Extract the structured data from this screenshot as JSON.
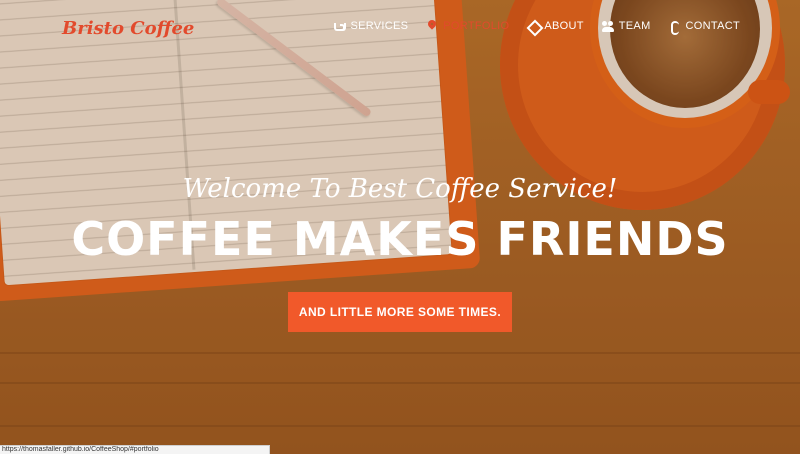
{
  "brand": "Bristo Coffee",
  "nav": {
    "items": [
      {
        "label": "SERVICES",
        "icon": "coffee-cup-icon"
      },
      {
        "label": "PORTFOLIO",
        "icon": "map-pin-icon",
        "active": true
      },
      {
        "label": "ABOUT",
        "icon": "diamond-icon"
      },
      {
        "label": "TEAM",
        "icon": "users-icon"
      },
      {
        "label": "CONTACT",
        "icon": "phone-icon"
      }
    ]
  },
  "hero": {
    "subtitle": "Welcome To Best Coffee Service!",
    "headline": "COFFEE MAKES FRIENDS",
    "cta_label": "AND LITTLE MORE SOME TIMES."
  },
  "status_url": "https://thomasfaller.github.io/CoffeeShop/#portfolio",
  "colors": {
    "accent": "#f1592a",
    "brand": "#e24a2c"
  }
}
